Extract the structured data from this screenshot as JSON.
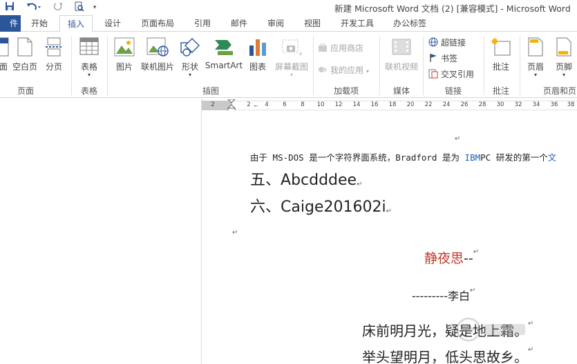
{
  "titlebar": {
    "title": "新建 Microsoft Word 文档 (2) [兼容模式] - Microsoft Word"
  },
  "tabs": [
    {
      "label": "件"
    },
    {
      "label": "开始"
    },
    {
      "label": "插入"
    },
    {
      "label": "设计"
    },
    {
      "label": "页面布局"
    },
    {
      "label": "引用"
    },
    {
      "label": "邮件"
    },
    {
      "label": "审阅"
    },
    {
      "label": "视图"
    },
    {
      "label": "开发工具"
    },
    {
      "label": "办公标签"
    }
  ],
  "ribbon": {
    "pages": {
      "label": "页面",
      "items": [
        "面",
        "空白页",
        "分页"
      ]
    },
    "table": {
      "label": "表格",
      "items": [
        "表格"
      ]
    },
    "illustrations": {
      "label": "插图",
      "items": [
        "图片",
        "联机图片",
        "形状",
        "SmartArt",
        "图表",
        "屏幕截图"
      ]
    },
    "addins": {
      "label": "加载项",
      "items": [
        "应用商店",
        "我的应用"
      ]
    },
    "media": {
      "label": "媒体",
      "items": [
        "联机视频"
      ]
    },
    "links": {
      "label": "链接",
      "items": [
        "超链接",
        "书签",
        "交叉引用"
      ]
    },
    "comments": {
      "label": "批注",
      "items": [
        "批注"
      ]
    },
    "header_footer": {
      "label": "页眉和页",
      "items": [
        "页眉",
        "页脚"
      ]
    }
  },
  "ruler": {
    "ticks": [
      "2",
      "2",
      "2",
      "4",
      "6",
      "8",
      "10",
      "12",
      "14",
      "16",
      "18",
      "20",
      "22",
      "24",
      "26",
      "28",
      "30",
      "32",
      "34",
      "36",
      "38"
    ]
  },
  "document": {
    "line1_a": "由于",
    "line1_b": "MS-DOS",
    "line1_c": "是一个字符界面系统，",
    "line1_d": "Bradford",
    "line1_e": "是为",
    "line1_f": "IBM",
    "line1_g": "PC",
    "line1_h": "研发的第一个",
    "line1_i": "文",
    "item5_num": "五、",
    "item5_text": "Abcdddee",
    "item6_num": "六、",
    "item6_text": "Caige201602i",
    "poem_title": "静夜思",
    "poem_title_suffix": "--",
    "poem_author_prefix": "---------",
    "poem_author": "李白",
    "poem_line1": "床前明月光，疑是地上霜。",
    "poem_line2": "举头望明月，低头思故乡。",
    "para_mark": "↵"
  },
  "colors": {
    "brand": "#2b579a",
    "link": "#1a5fb4",
    "title_red": "#c0392b"
  }
}
